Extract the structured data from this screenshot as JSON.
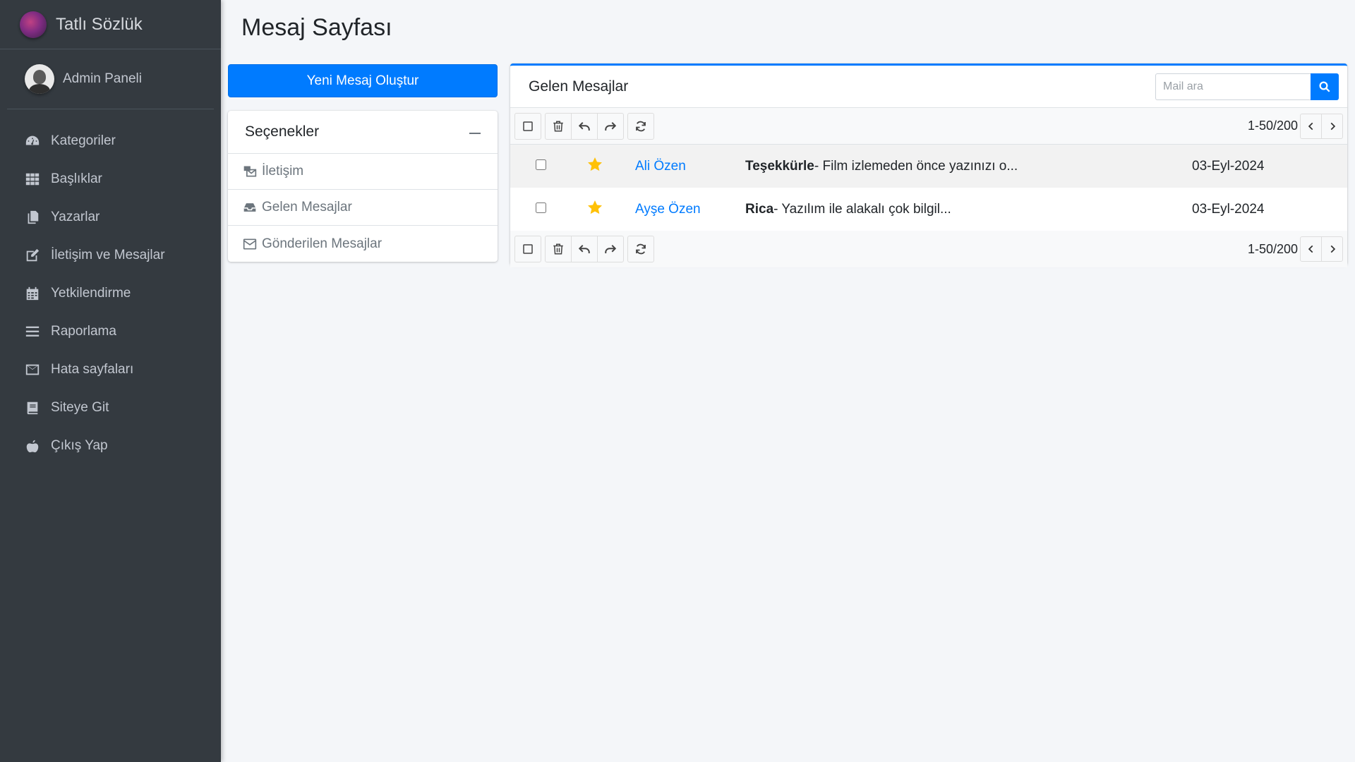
{
  "brand": {
    "name": "Tatlı Sözlük"
  },
  "user": {
    "name": "Admin Paneli"
  },
  "nav": {
    "items": [
      {
        "label": "Kategoriler",
        "icon": "dashboard-icon"
      },
      {
        "label": "Başlıklar",
        "icon": "grid-icon"
      },
      {
        "label": "Yazarlar",
        "icon": "copy-icon"
      },
      {
        "label": "İletişim ve Mesajlar",
        "icon": "edit-icon"
      },
      {
        "label": "Yetkilendirme",
        "icon": "calendar-icon"
      },
      {
        "label": "Raporlama",
        "icon": "bars-icon"
      },
      {
        "label": "Hata sayfaları",
        "icon": "envelope-icon"
      },
      {
        "label": "Siteye Git",
        "icon": "book-icon"
      },
      {
        "label": "Çıkış Yap",
        "icon": "apple-icon"
      }
    ]
  },
  "page": {
    "title": "Mesaj Sayfası"
  },
  "compose": {
    "label": "Yeni Mesaj Oluştur"
  },
  "options": {
    "title": "Seçenekler",
    "items": [
      {
        "label": "İletişim",
        "icon": "mail-bulk-icon"
      },
      {
        "label": "Gelen Mesajlar",
        "icon": "inbox-icon"
      },
      {
        "label": "Gönderilen Mesajlar",
        "icon": "envelope-icon"
      }
    ]
  },
  "mailbox": {
    "title": "Gelen Mesajlar",
    "search_placeholder": "Mail ara",
    "pager_text": "1-50/200",
    "messages": [
      {
        "sender": "Ali Özen",
        "subject": "Teşekkürle",
        "preview": "- Film izlemeden önce yazınızı o...",
        "date": "03-Eyl-2024",
        "starred": true
      },
      {
        "sender": "Ayşe Özen",
        "subject": "Rica",
        "preview": "- Yazılım ile alakalı çok bilgil...",
        "date": "03-Eyl-2024",
        "starred": true
      }
    ]
  },
  "colors": {
    "sidebar": "#343a40",
    "primary": "#007bff",
    "star": "#ffc107",
    "background": "#f4f6f9"
  }
}
